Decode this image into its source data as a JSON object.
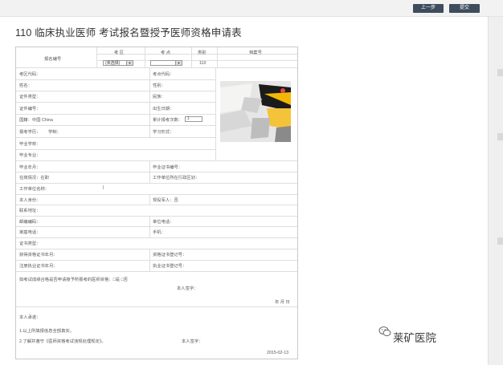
{
  "toolbar": {
    "prev_label": "上一步",
    "submit_label": "提交"
  },
  "title": "110 临床执业医师 考试报名暨授予医师资格申请表",
  "header": {
    "reg_no_label": "报名编号",
    "col_exam_area": "考 区",
    "col_exam_point": "考 点",
    "col_category": "类别",
    "col_file_no": "档案号",
    "exam_area_select": "(未选择)",
    "exam_point_select": "",
    "category_value": "110"
  },
  "fields": {
    "exam_area_code": "考区代码：",
    "exam_point_code": "考点代码：",
    "name": "姓名：",
    "gender": "性别：",
    "id_type": "证件类型：",
    "ethnicity": "民族：",
    "id_number": "证件编号：",
    "birth_date": "出生日期：",
    "nationality": "国籍：中国 China",
    "cumulative_exam_label": "累计报考次数：",
    "cumulative_exam_value": "1",
    "education_label": "报考学历：",
    "education_value": "学制：",
    "study_form": "学习形式：",
    "graduate_school": "毕业学校：",
    "graduate_major": "毕业专业：",
    "graduate_year": "毕业年月：",
    "diploma_no": "毕业证书编号：",
    "work_status": "在岗情况：在职",
    "work_region": "工作单位所在行政区划：",
    "work_unit": "工作单位名称：",
    "work_unit_marker": "|",
    "identity": "本人身份：",
    "military": "现役军人：否",
    "address": "联系地址：",
    "postcode": "邮编编码：",
    "unit_phone": "单位电话：",
    "home_phone": "家庭电话：",
    "mobile": "手机：",
    "cert_type": "证书类型：",
    "qual_cert_year": "获得资格证书年月：",
    "qual_cert_no": "资格证书登记号：",
    "license_year": "注册执业证书年月：",
    "license_no": "执业证书登记号："
  },
  "apply_section": {
    "question": "如考试成绩合格是否申请授予所报考的医师资格：□是 □否",
    "signature": "本人签字：",
    "date": "年 月 日"
  },
  "promise_section": {
    "heading": "本人承诺：",
    "item1": "1.以上所填报信息全部真实。",
    "item2": "2.了解并遵守《医师资格考试违规处理规定》。",
    "signature": "本人签字：",
    "date": "2015-02-13"
  },
  "watermark": {
    "text": "莱矿医院"
  },
  "colors": {
    "toolbar_button": "#3f4c5e",
    "border": "#c9c9c9"
  }
}
